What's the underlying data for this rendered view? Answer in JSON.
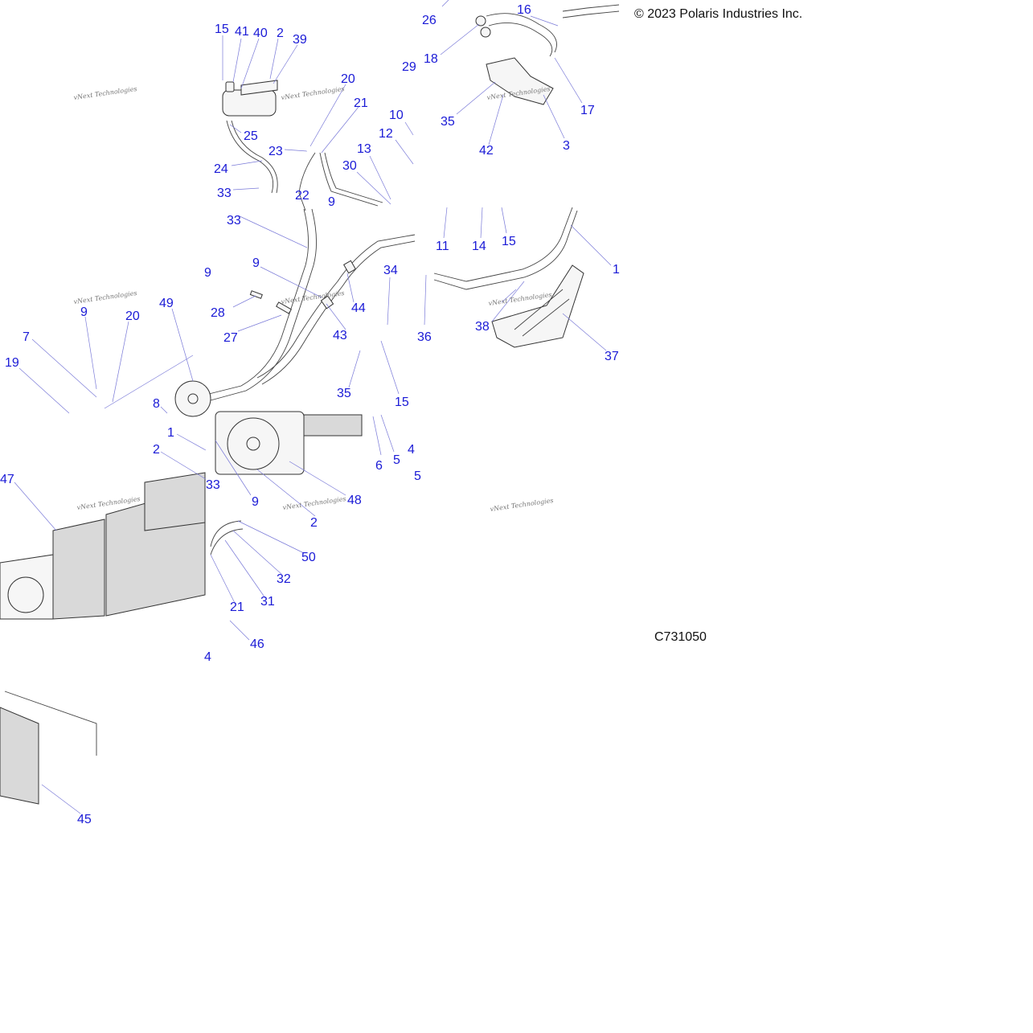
{
  "copyright": "© 2023 Polaris Industries Inc.",
  "figure_code": "C731050",
  "watermark_text": "vNext Technologies",
  "callout_color": "#1a1ad6",
  "callouts": [
    "15",
    "41",
    "40",
    "2",
    "39",
    "20",
    "21",
    "25",
    "23",
    "24",
    "33",
    "22",
    "9",
    "33",
    "26",
    "16",
    "18",
    "29",
    "35",
    "42",
    "3",
    "17",
    "10",
    "12",
    "13",
    "30",
    "11",
    "14",
    "15",
    "1",
    "9",
    "9",
    "28",
    "27",
    "43",
    "44",
    "34",
    "36",
    "38",
    "37",
    "49",
    "9",
    "20",
    "7",
    "19",
    "8",
    "35",
    "15",
    "6",
    "5",
    "4",
    "5",
    "1",
    "2",
    "33",
    "47",
    "9",
    "48",
    "2",
    "50",
    "32",
    "31",
    "21",
    "46",
    "4",
    "45"
  ]
}
